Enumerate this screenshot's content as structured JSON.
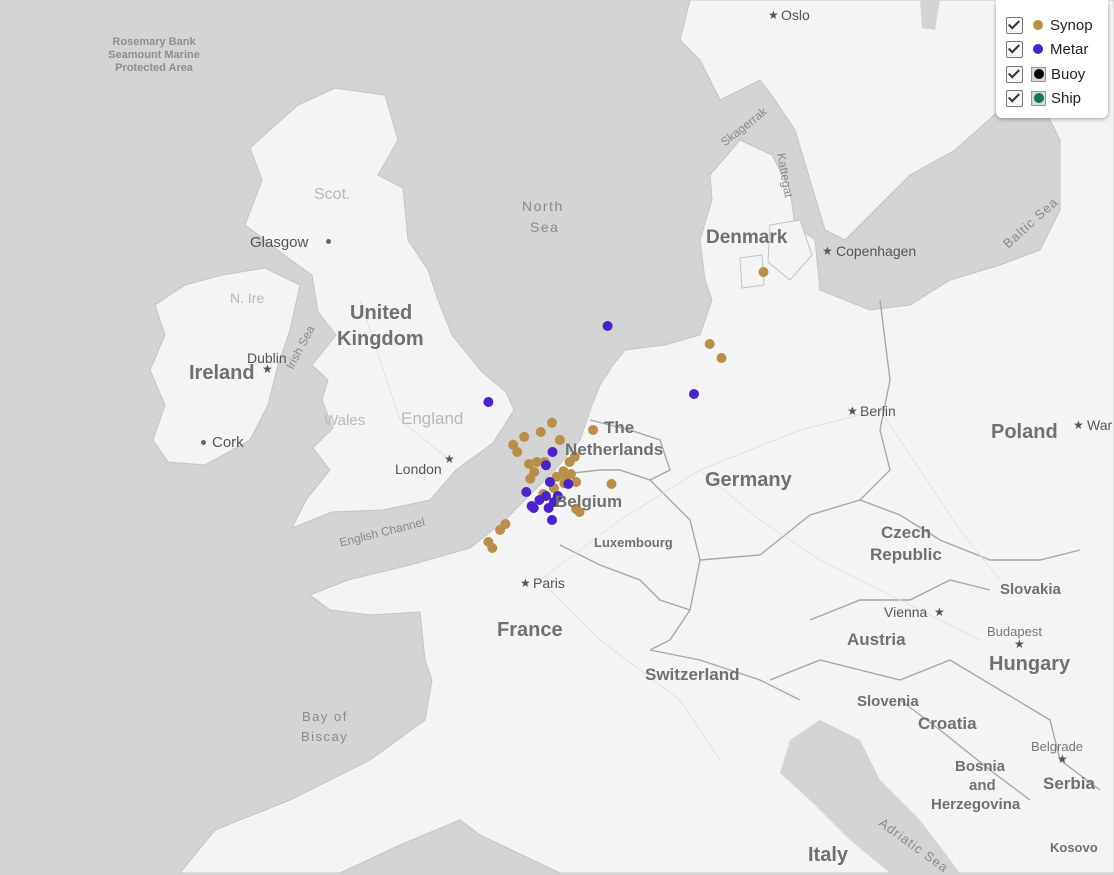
{
  "legend": [
    {
      "label": "Synop",
      "color": "#b98e48",
      "boxed": false,
      "icon": "dot-icon"
    },
    {
      "label": "Metar",
      "color": "#4a22c8",
      "boxed": false,
      "icon": "dot-icon"
    },
    {
      "label": "Buoy",
      "color": "#000000",
      "boxed": true,
      "icon": "dot-icon"
    },
    {
      "label": "Ship",
      "color": "#12735f",
      "boxed": true,
      "icon": "dot-icon"
    }
  ],
  "labels": {
    "rosemary": "Rosemary Bank Seamount Marine Protected Area",
    "scot": "Scot.",
    "glasgow": "Glasgow",
    "uk1": "United",
    "uk2": "Kingdom",
    "nire": "N. Ire",
    "ireland": "Ireland",
    "dublin": "Dublin",
    "irish_sea": "Irish Sea",
    "cork": "Cork",
    "wales": "Wales",
    "england": "England",
    "london": "London",
    "english_channel": "English Channel",
    "north_sea_1": "North",
    "north_sea_2": "Sea",
    "skagerrak": "Skagerrak",
    "kattegat": "Kattegat",
    "oslo": "Oslo",
    "denmark": "Denmark",
    "copenhagen": "Copenhagen",
    "baltic": "Baltic Sea",
    "nl1": "The",
    "nl2": "Netherlands",
    "belgium": "Belgium",
    "luxembourg": "Luxembourg",
    "paris": "Paris",
    "france": "France",
    "germany": "Germany",
    "berlin": "Berlin",
    "poland": "Poland",
    "warsaw": "War",
    "czech1": "Czech",
    "czech2": "Republic",
    "slovakia": "Slovakia",
    "vienna": "Vienna",
    "austria": "Austria",
    "budapest": "Budapest",
    "hungary": "Hungary",
    "switzerland": "Switzerland",
    "slovenia": "Slovenia",
    "croatia": "Croatia",
    "belgrade": "Belgrade",
    "bosnia1": "Bosnia",
    "bosnia2": "and",
    "bosnia3": "Herzegovina",
    "serbia": "Serbia",
    "kosovo": "Kosovo",
    "italy": "Italy",
    "adriatic": "Adriatic Sea",
    "biscay1": "Bay of",
    "biscay2": "Biscay"
  },
  "stations": {
    "synop": [
      [
        3.2,
        52.38
      ],
      [
        3.35,
        52.2
      ],
      [
        4.68,
        52.93
      ],
      [
        4.25,
        52.7
      ],
      [
        3.62,
        52.58
      ],
      [
        4.98,
        52.5
      ],
      [
        5.55,
        52.08
      ],
      [
        6.25,
        52.75
      ],
      [
        3.8,
        51.9
      ],
      [
        4.1,
        51.95
      ],
      [
        4.4,
        51.95
      ],
      [
        5.12,
        51.72
      ],
      [
        5.35,
        51.95
      ],
      [
        5.4,
        51.65
      ],
      [
        4.0,
        51.7
      ],
      [
        3.85,
        51.53
      ],
      [
        4.85,
        51.58
      ],
      [
        5.22,
        51.55
      ],
      [
        4.75,
        51.3
      ],
      [
        4.35,
        51.15
      ],
      [
        5.15,
        51.42
      ],
      [
        5.6,
        51.45
      ],
      [
        6.95,
        51.4
      ],
      [
        5.6,
        50.78
      ],
      [
        5.73,
        50.7
      ],
      [
        2.9,
        50.4
      ],
      [
        2.7,
        50.25
      ],
      [
        2.25,
        49.95
      ],
      [
        2.4,
        49.8
      ],
      [
        12.75,
        56.7
      ],
      [
        10.7,
        54.9
      ],
      [
        11.15,
        54.55
      ]
    ],
    "metar": [
      [
        2.25,
        53.45
      ],
      [
        6.8,
        55.35
      ],
      [
        4.7,
        52.2
      ],
      [
        4.45,
        51.87
      ],
      [
        4.6,
        51.45
      ],
      [
        5.3,
        51.4
      ],
      [
        3.7,
        51.2
      ],
      [
        4.2,
        51.0
      ],
      [
        4.9,
        51.1
      ],
      [
        4.45,
        51.1
      ],
      [
        3.9,
        50.85
      ],
      [
        3.98,
        50.8
      ],
      [
        4.55,
        50.8
      ],
      [
        4.75,
        50.95
      ],
      [
        4.68,
        50.5
      ],
      [
        10.1,
        53.65
      ]
    ],
    "buoy": [],
    "ship": []
  }
}
